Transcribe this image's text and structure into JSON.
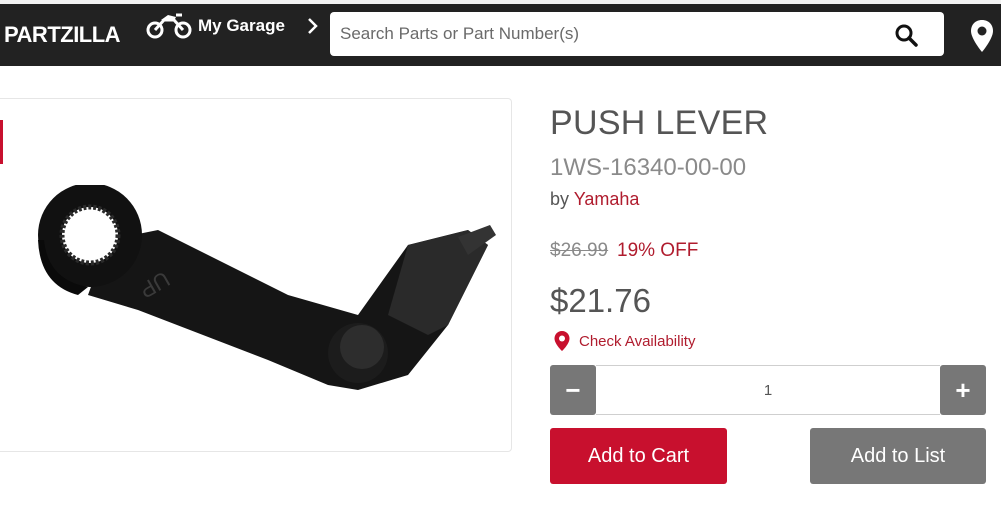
{
  "header": {
    "logo": "PARTZILLA",
    "garage_label": "My Garage",
    "search_placeholder": "Search Parts or Part Number(s)",
    "search_value": ""
  },
  "product": {
    "title": "PUSH LEVER",
    "part_number": "1WS-16340-00-00",
    "by_prefix": "by ",
    "brand": "Yamaha",
    "original_price": "$26.99",
    "discount": "19% OFF",
    "price": "$21.76",
    "availability_label": "Check Availability",
    "quantity": "1",
    "minus_label": "−",
    "plus_label": "+",
    "add_to_cart": "Add to Cart",
    "add_to_list": "Add to List"
  },
  "colors": {
    "header_bg": "#222222",
    "brand_red": "#c8102e",
    "button_gray": "#777777"
  },
  "icons": [
    "motorcycle-icon",
    "chevron-right-icon",
    "search-icon",
    "map-pin-icon"
  ]
}
